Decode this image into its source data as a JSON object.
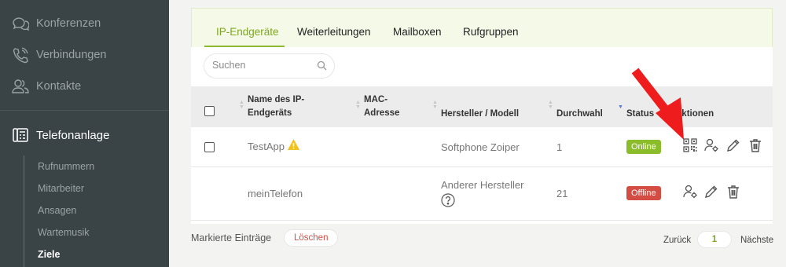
{
  "sidebar": {
    "items": [
      {
        "label": "Konferenzen",
        "icon": "chat-bubbles-icon"
      },
      {
        "label": "Verbindungen",
        "icon": "phone-icon"
      },
      {
        "label": "Kontakte",
        "icon": "contacts-icon"
      },
      {
        "label": "Telefonanlage",
        "icon": "pbx-icon"
      }
    ],
    "subitems": [
      "Rufnummern",
      "Mitarbeiter",
      "Ansagen",
      "Wartemusik",
      "Ziele"
    ]
  },
  "tabs": [
    "IP-Endgeräte",
    "Weiterleitungen",
    "Mailboxen",
    "Rufgruppen"
  ],
  "search": {
    "placeholder": "Suchen"
  },
  "table": {
    "headers": {
      "name_line1": "Name des IP-",
      "name_line2": "Endgeräts",
      "mac_line1": "MAC-",
      "mac_line2": "Adresse",
      "vendor": "Hersteller / Modell",
      "extension": "Durchwahl",
      "status": "Status",
      "actions": "Aktionen"
    },
    "rows": [
      {
        "name": "TestApp",
        "vendor": "Softphone Zoiper",
        "extension": "1",
        "status": "Online"
      },
      {
        "name": "meinTelefon",
        "vendor": "Anderer Hersteller",
        "extension": "21",
        "status": "Offline"
      }
    ]
  },
  "footer": {
    "marked": "Markierte Einträge",
    "delete": "Löschen"
  },
  "pagination": {
    "prev": "Zurück",
    "page": "1",
    "next": "Nächste"
  },
  "colors": {
    "accent": "#8cb92d",
    "online": "#8bbd2a",
    "offline": "#d44d43",
    "sidebar": "#3a4346",
    "arrow": "#ee1c1c"
  }
}
